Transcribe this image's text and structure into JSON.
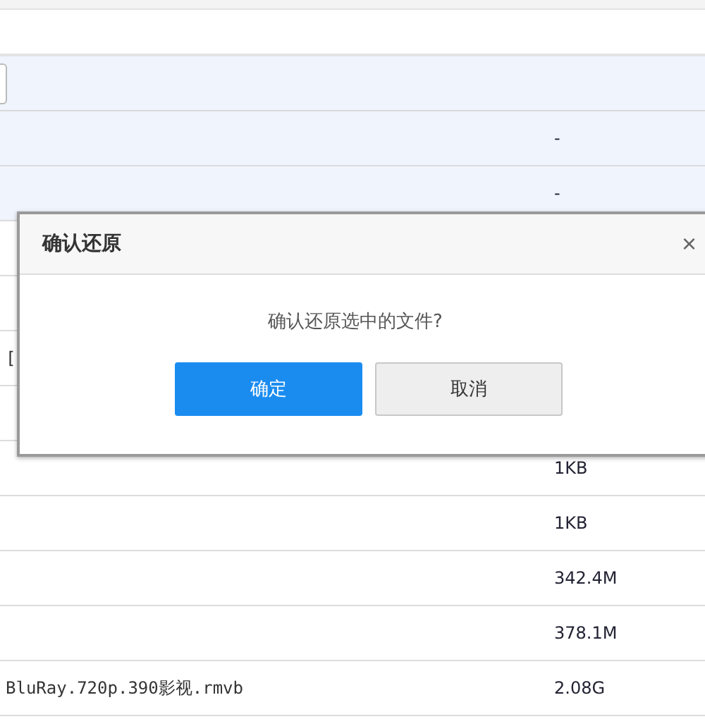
{
  "table": {
    "rows": [
      {
        "name": "",
        "size": "-",
        "highlighted": true
      },
      {
        "name": "",
        "size": "-",
        "highlighted": true
      },
      {
        "name": "",
        "size": "",
        "highlighted": false
      },
      {
        "name": "",
        "size": "",
        "highlighted": false
      },
      {
        "name": "[",
        "size": "",
        "highlighted": false
      },
      {
        "name": "",
        "size": "",
        "highlighted": false
      },
      {
        "name": "",
        "size": "1KB",
        "highlighted": false
      },
      {
        "name": "",
        "size": "1KB",
        "highlighted": false
      },
      {
        "name": "",
        "size": "342.4M",
        "highlighted": false
      },
      {
        "name": "",
        "size": "378.1M",
        "highlighted": false
      },
      {
        "name": "BluRay.720p.390影视.rmvb",
        "size": "2.08G",
        "highlighted": false
      }
    ]
  },
  "dialog": {
    "title": "确认还原",
    "close": "×",
    "message": "确认还原选中的文件?",
    "buttons": [
      {
        "label": "确定",
        "kind": "primary"
      },
      {
        "label": "取消",
        "kind": "secondary"
      }
    ]
  }
}
